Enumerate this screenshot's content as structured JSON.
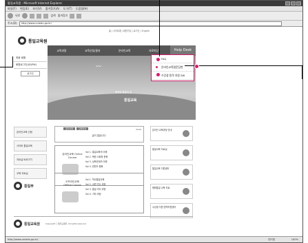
{
  "window": {
    "title": "통일교육원 - Microsoft Internet Explorer"
  },
  "menu": [
    "파일(F)",
    "편집(E)",
    "보기(V)",
    "즐겨찾기(A)",
    "도구(T)",
    "도움말(H)"
  ],
  "toolbar": {
    "back": "뒤로",
    "search": "검색",
    "favorites": "즐겨찾기"
  },
  "address": {
    "label": "주소(D)",
    "url": "http://www.uniedu.go.kr/",
    "go": "이동"
  },
  "site": {
    "toplinks": "홈  |  사이트맵  |  회원가입  |  로그인  |  English",
    "logo": "통일교육원",
    "gnb": [
      "교육과정",
      "교육신청/결과",
      "온라인교육",
      "자료마당",
      "정보마당"
    ],
    "helpdesk": "Help Desk",
    "leftnav": [
      "최종 회원",
      "회원로그인(ID/PW)"
    ],
    "leftnav_btn": "로그인",
    "hero_title": "통일교육",
    "hero_tag": "평화와 통일의 길",
    "dropdown": [
      "FAQ",
      "온라인교육질문답변",
      "수강생 원격 지원 SW"
    ],
    "left_banners": [
      "온라인교육 신청",
      "사이버 통일교육",
      "자료실 바로가기",
      "교육 자료실"
    ],
    "left_logo": "통일부",
    "notice": {
      "tabs": [
        "공지사항",
        "교육안내"
      ],
      "more": "more",
      "empty": "글이 없습니다."
    },
    "courses": [
      {
        "label": "온라인교육 Online Course",
        "items": [
          "Vol 1. 통일교육의 이해",
          "Vol 2. 북한 사회와 문화",
          "Vol 3. 남북관계의 이해",
          "Vol 4. 한반도 평화"
        ]
      },
      {
        "label": "오프라인교육 Offline Course",
        "items": [
          "Vol 1. 학교통일교육",
          "Vol 2. 교원 연수 과정",
          "Vol 3. 통일 리더 과정",
          "Vol 4. 기타 과정"
        ]
      }
    ],
    "right_banners": [
      "온라인 교육과정 안내",
      "통일교육 자료실",
      "통일교육 지원센터",
      "평화통일 교육 자료",
      "수강생 지원 원격지원센터"
    ],
    "footer_logo": "통일교육원",
    "footer_addr": "Copyright ⓒ 통일교육원. All rights reserved."
  },
  "status": {
    "url": "http://www.uniedu.go.kr/",
    "zone": "인터넷",
    "zoom": "100%"
  }
}
